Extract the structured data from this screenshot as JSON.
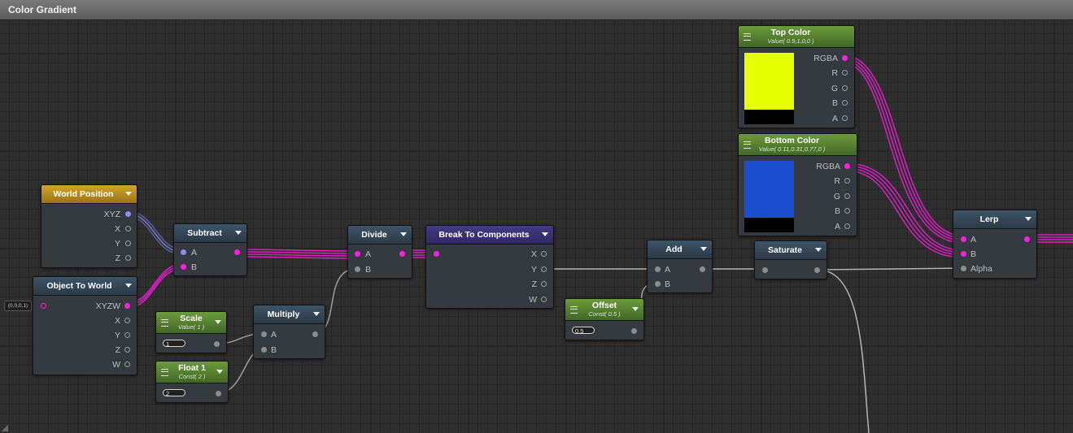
{
  "window": {
    "title": "Color Gradient"
  },
  "nodes": {
    "world_position": {
      "title": "World Position",
      "ports": [
        "XYZ",
        "X",
        "Y",
        "Z"
      ]
    },
    "object_to_world": {
      "title": "Object To World",
      "default_value": "(0,0,0,1)",
      "ports": [
        "XYZW",
        "X",
        "Y",
        "Z",
        "W"
      ]
    },
    "subtract": {
      "title": "Subtract",
      "inputs": [
        "A",
        "B"
      ]
    },
    "scale": {
      "title": "Scale",
      "subtitle": "Value( 1 )",
      "value": "1"
    },
    "float1": {
      "title": "Float 1",
      "subtitle": "Const( 2 )",
      "value": "2"
    },
    "multiply": {
      "title": "Multiply",
      "inputs": [
        "A",
        "B"
      ]
    },
    "divide": {
      "title": "Divide",
      "inputs": [
        "A",
        "B"
      ]
    },
    "break_to_components": {
      "title": "Break To Components",
      "ports": [
        "X",
        "Y",
        "Z",
        "W"
      ]
    },
    "offset": {
      "title": "Offset",
      "subtitle": "Const( 0.5 )",
      "value": "0.5"
    },
    "add": {
      "title": "Add",
      "inputs": [
        "A",
        "B"
      ]
    },
    "saturate": {
      "title": "Saturate"
    },
    "top_color": {
      "title": "Top Color",
      "subtitle": "Value( 0.9,1,0,0 )",
      "ports": [
        "RGBA",
        "R",
        "G",
        "B",
        "A"
      ],
      "swatch": "#e6ff00"
    },
    "bottom_color": {
      "title": "Bottom Color",
      "subtitle": "Value( 0.11,0.31,0.77,0 )",
      "ports": [
        "RGBA",
        "R",
        "G",
        "B",
        "A"
      ],
      "swatch": "#1c4fd0"
    },
    "lerp": {
      "title": "Lerp",
      "inputs": [
        "A",
        "B",
        "Alpha"
      ]
    }
  },
  "colors": {
    "color_wire": "#ff1fe0",
    "vector_wire": "#8d8df2",
    "float_wire": "#b8b8b8"
  }
}
